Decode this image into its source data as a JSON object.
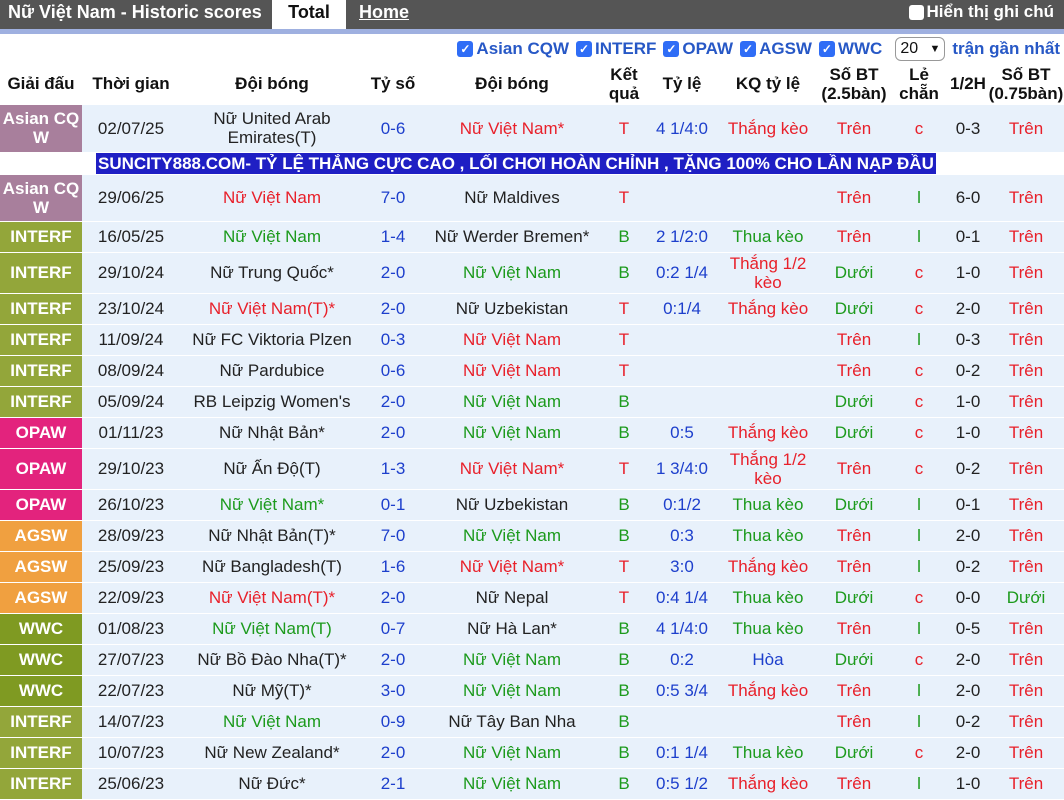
{
  "header": {
    "title": "Nữ Việt Nam - Historic scores",
    "tab_total": "Total",
    "tab_home": "Home",
    "notes_label": "Hiển thị ghi chú"
  },
  "filters": {
    "items": [
      "Asian CQW",
      "INTERF",
      "OPAW",
      "AGSW",
      "WWC"
    ],
    "count_value": "20",
    "recent_label": "trận gần nhất"
  },
  "columns": [
    "Giải đấu",
    "Thời gian",
    "Đội bóng",
    "Tỷ số",
    "Đội bóng",
    "Kết quả",
    "Tỷ lệ",
    "KQ tỷ lệ",
    "Số BT (2.5bàn)",
    "Lẻ chẵn",
    "1/2H",
    "Số BT (0.75bàn)"
  ],
  "ad_text": "SUNCITY888.COM- TỶ LỆ THẮNG CỰC CAO , LỐI CHƠI HOÀN CHỈNH , TẶNG 100% CHO LẦN NẠP ĐẦU",
  "colors": {
    "Asian CQW": "#a87f9c",
    "INTERF": "#93a63a",
    "OPAW": "#e3237d",
    "AGSW": "#f0a040",
    "WWC": "#7f9a22",
    "win": "#e8202a",
    "lose": "#1c9a1c",
    "score": "#1d3fcc"
  },
  "rows": [
    {
      "league": "Asian CQ W",
      "date": "02/07/25",
      "home": "Nữ United Arab Emirates(T)",
      "home_c": "dark",
      "score": "0-6",
      "away": "Nữ Việt Nam*",
      "away_c": "red",
      "result": "T",
      "odds": "4 1/4:0",
      "odds_res": "Thắng kèo",
      "odds_res_c": "red",
      "ou25": "Trên",
      "ou25_c": "red",
      "oe": "c",
      "oe_c": "red",
      "half": "0-3",
      "ou075": "Trên",
      "ou075_c": "red"
    },
    {
      "ad": true
    },
    {
      "league": "Asian CQ W",
      "date": "29/06/25",
      "home": "Nữ Việt Nam",
      "home_c": "red",
      "score": "7-0",
      "away": "Nữ Maldives",
      "away_c": "dark",
      "result": "T",
      "odds": "",
      "odds_res": "",
      "odds_res_c": "red",
      "ou25": "Trên",
      "ou25_c": "red",
      "oe": "l",
      "oe_c": "green",
      "half": "6-0",
      "ou075": "Trên",
      "ou075_c": "red"
    },
    {
      "league": "INTERF",
      "date": "16/05/25",
      "home": "Nữ Việt Nam",
      "home_c": "green",
      "score": "1-4",
      "away": "Nữ Werder Bremen*",
      "away_c": "dark",
      "result": "B",
      "odds": "2 1/2:0",
      "odds_res": "Thua kèo",
      "odds_res_c": "green",
      "ou25": "Trên",
      "ou25_c": "red",
      "oe": "l",
      "oe_c": "green",
      "half": "0-1",
      "ou075": "Trên",
      "ou075_c": "red"
    },
    {
      "league": "INTERF",
      "date": "29/10/24",
      "home": "Nữ Trung Quốc*",
      "home_c": "dark",
      "score": "2-0",
      "away": "Nữ Việt Nam",
      "away_c": "green",
      "result": "B",
      "odds": "0:2 1/4",
      "odds_res": "Thắng 1/2 kèo",
      "odds_res_c": "red",
      "ou25": "Dưới",
      "ou25_c": "green",
      "oe": "c",
      "oe_c": "red",
      "half": "1-0",
      "ou075": "Trên",
      "ou075_c": "red"
    },
    {
      "league": "INTERF",
      "date": "23/10/24",
      "home": "Nữ Việt Nam(T)*",
      "home_c": "red",
      "score": "2-0",
      "away": "Nữ Uzbekistan",
      "away_c": "dark",
      "result": "T",
      "odds": "0:1/4",
      "odds_res": "Thắng kèo",
      "odds_res_c": "red",
      "ou25": "Dưới",
      "ou25_c": "green",
      "oe": "c",
      "oe_c": "red",
      "half": "2-0",
      "ou075": "Trên",
      "ou075_c": "red"
    },
    {
      "league": "INTERF",
      "date": "11/09/24",
      "home": "Nữ FC Viktoria Plzen",
      "home_c": "dark",
      "score": "0-3",
      "away": "Nữ Việt Nam",
      "away_c": "red",
      "result": "T",
      "odds": "",
      "odds_res": "",
      "odds_res_c": "red",
      "ou25": "Trên",
      "ou25_c": "red",
      "oe": "l",
      "oe_c": "green",
      "half": "0-3",
      "ou075": "Trên",
      "ou075_c": "red"
    },
    {
      "league": "INTERF",
      "date": "08/09/24",
      "home": "Nữ Pardubice",
      "home_c": "dark",
      "score": "0-6",
      "away": "Nữ Việt Nam",
      "away_c": "red",
      "result": "T",
      "odds": "",
      "odds_res": "",
      "odds_res_c": "red",
      "ou25": "Trên",
      "ou25_c": "red",
      "oe": "c",
      "oe_c": "red",
      "half": "0-2",
      "ou075": "Trên",
      "ou075_c": "red"
    },
    {
      "league": "INTERF",
      "date": "05/09/24",
      "home": "RB Leipzig Women's",
      "home_c": "dark",
      "score": "2-0",
      "away": "Nữ Việt Nam",
      "away_c": "green",
      "result": "B",
      "odds": "",
      "odds_res": "",
      "odds_res_c": "red",
      "ou25": "Dưới",
      "ou25_c": "green",
      "oe": "c",
      "oe_c": "red",
      "half": "1-0",
      "ou075": "Trên",
      "ou075_c": "red"
    },
    {
      "league": "OPAW",
      "date": "01/11/23",
      "home": "Nữ Nhật Bản*",
      "home_c": "dark",
      "score": "2-0",
      "away": "Nữ Việt Nam",
      "away_c": "green",
      "result": "B",
      "odds": "0:5",
      "odds_res": "Thắng kèo",
      "odds_res_c": "red",
      "ou25": "Dưới",
      "ou25_c": "green",
      "oe": "c",
      "oe_c": "red",
      "half": "1-0",
      "ou075": "Trên",
      "ou075_c": "red"
    },
    {
      "league": "OPAW",
      "date": "29/10/23",
      "home": "Nữ Ấn Độ(T)",
      "home_c": "dark",
      "score": "1-3",
      "away": "Nữ Việt Nam*",
      "away_c": "red",
      "result": "T",
      "odds": "1 3/4:0",
      "odds_res": "Thắng 1/2 kèo",
      "odds_res_c": "red",
      "ou25": "Trên",
      "ou25_c": "red",
      "oe": "c",
      "oe_c": "red",
      "half": "0-2",
      "ou075": "Trên",
      "ou075_c": "red"
    },
    {
      "league": "OPAW",
      "date": "26/10/23",
      "home": "Nữ Việt Nam*",
      "home_c": "green",
      "score": "0-1",
      "away": "Nữ Uzbekistan",
      "away_c": "dark",
      "result": "B",
      "odds": "0:1/2",
      "odds_res": "Thua kèo",
      "odds_res_c": "green",
      "ou25": "Dưới",
      "ou25_c": "green",
      "oe": "l",
      "oe_c": "green",
      "half": "0-1",
      "ou075": "Trên",
      "ou075_c": "red"
    },
    {
      "league": "AGSW",
      "date": "28/09/23",
      "home": "Nữ Nhật Bản(T)*",
      "home_c": "dark",
      "score": "7-0",
      "away": "Nữ Việt Nam",
      "away_c": "green",
      "result": "B",
      "odds": "0:3",
      "odds_res": "Thua kèo",
      "odds_res_c": "green",
      "ou25": "Trên",
      "ou25_c": "red",
      "oe": "l",
      "oe_c": "green",
      "half": "2-0",
      "ou075": "Trên",
      "ou075_c": "red"
    },
    {
      "league": "AGSW",
      "date": "25/09/23",
      "home": "Nữ Bangladesh(T)",
      "home_c": "dark",
      "score": "1-6",
      "away": "Nữ Việt Nam*",
      "away_c": "red",
      "result": "T",
      "odds": "3:0",
      "odds_res": "Thắng kèo",
      "odds_res_c": "red",
      "ou25": "Trên",
      "ou25_c": "red",
      "oe": "l",
      "oe_c": "green",
      "half": "0-2",
      "ou075": "Trên",
      "ou075_c": "red"
    },
    {
      "league": "AGSW",
      "date": "22/09/23",
      "home": "Nữ Việt Nam(T)*",
      "home_c": "red",
      "score": "2-0",
      "away": "Nữ Nepal",
      "away_c": "dark",
      "result": "T",
      "odds": "0:4 1/4",
      "odds_res": "Thua kèo",
      "odds_res_c": "green",
      "ou25": "Dưới",
      "ou25_c": "green",
      "oe": "c",
      "oe_c": "red",
      "half": "0-0",
      "ou075": "Dưới",
      "ou075_c": "green"
    },
    {
      "league": "WWC",
      "date": "01/08/23",
      "home": "Nữ Việt Nam(T)",
      "home_c": "green",
      "score": "0-7",
      "away": "Nữ Hà Lan*",
      "away_c": "dark",
      "result": "B",
      "odds": "4 1/4:0",
      "odds_res": "Thua kèo",
      "odds_res_c": "green",
      "ou25": "Trên",
      "ou25_c": "red",
      "oe": "l",
      "oe_c": "green",
      "half": "0-5",
      "ou075": "Trên",
      "ou075_c": "red"
    },
    {
      "league": "WWC",
      "date": "27/07/23",
      "home": "Nữ Bồ Đào Nha(T)*",
      "home_c": "dark",
      "score": "2-0",
      "away": "Nữ Việt Nam",
      "away_c": "green",
      "result": "B",
      "odds": "0:2",
      "odds_res": "Hòa",
      "odds_res_c": "blue",
      "ou25": "Dưới",
      "ou25_c": "green",
      "oe": "c",
      "oe_c": "red",
      "half": "2-0",
      "ou075": "Trên",
      "ou075_c": "red"
    },
    {
      "league": "WWC",
      "date": "22/07/23",
      "home": "Nữ Mỹ(T)*",
      "home_c": "dark",
      "score": "3-0",
      "away": "Nữ Việt Nam",
      "away_c": "green",
      "result": "B",
      "odds": "0:5 3/4",
      "odds_res": "Thắng kèo",
      "odds_res_c": "red",
      "ou25": "Trên",
      "ou25_c": "red",
      "oe": "l",
      "oe_c": "green",
      "half": "2-0",
      "ou075": "Trên",
      "ou075_c": "red"
    },
    {
      "league": "INTERF",
      "date": "14/07/23",
      "home": "Nữ Việt Nam",
      "home_c": "green",
      "score": "0-9",
      "away": "Nữ Tây Ban Nha",
      "away_c": "dark",
      "result": "B",
      "odds": "",
      "odds_res": "",
      "odds_res_c": "red",
      "ou25": "Trên",
      "ou25_c": "red",
      "oe": "l",
      "oe_c": "green",
      "half": "0-2",
      "ou075": "Trên",
      "ou075_c": "red"
    },
    {
      "league": "INTERF",
      "date": "10/07/23",
      "home": "Nữ New Zealand*",
      "home_c": "dark",
      "score": "2-0",
      "away": "Nữ Việt Nam",
      "away_c": "green",
      "result": "B",
      "odds": "0:1 1/4",
      "odds_res": "Thua kèo",
      "odds_res_c": "green",
      "ou25": "Dưới",
      "ou25_c": "green",
      "oe": "c",
      "oe_c": "red",
      "half": "2-0",
      "ou075": "Trên",
      "ou075_c": "red"
    },
    {
      "league": "INTERF",
      "date": "25/06/23",
      "home": "Nữ Đức*",
      "home_c": "dark",
      "score": "2-1",
      "away": "Nữ Việt Nam",
      "away_c": "green",
      "result": "B",
      "odds": "0:5 1/2",
      "odds_res": "Thắng kèo",
      "odds_res_c": "red",
      "ou25": "Trên",
      "ou25_c": "red",
      "oe": "l",
      "oe_c": "green",
      "half": "1-0",
      "ou075": "Trên",
      "ou075_c": "red"
    }
  ]
}
